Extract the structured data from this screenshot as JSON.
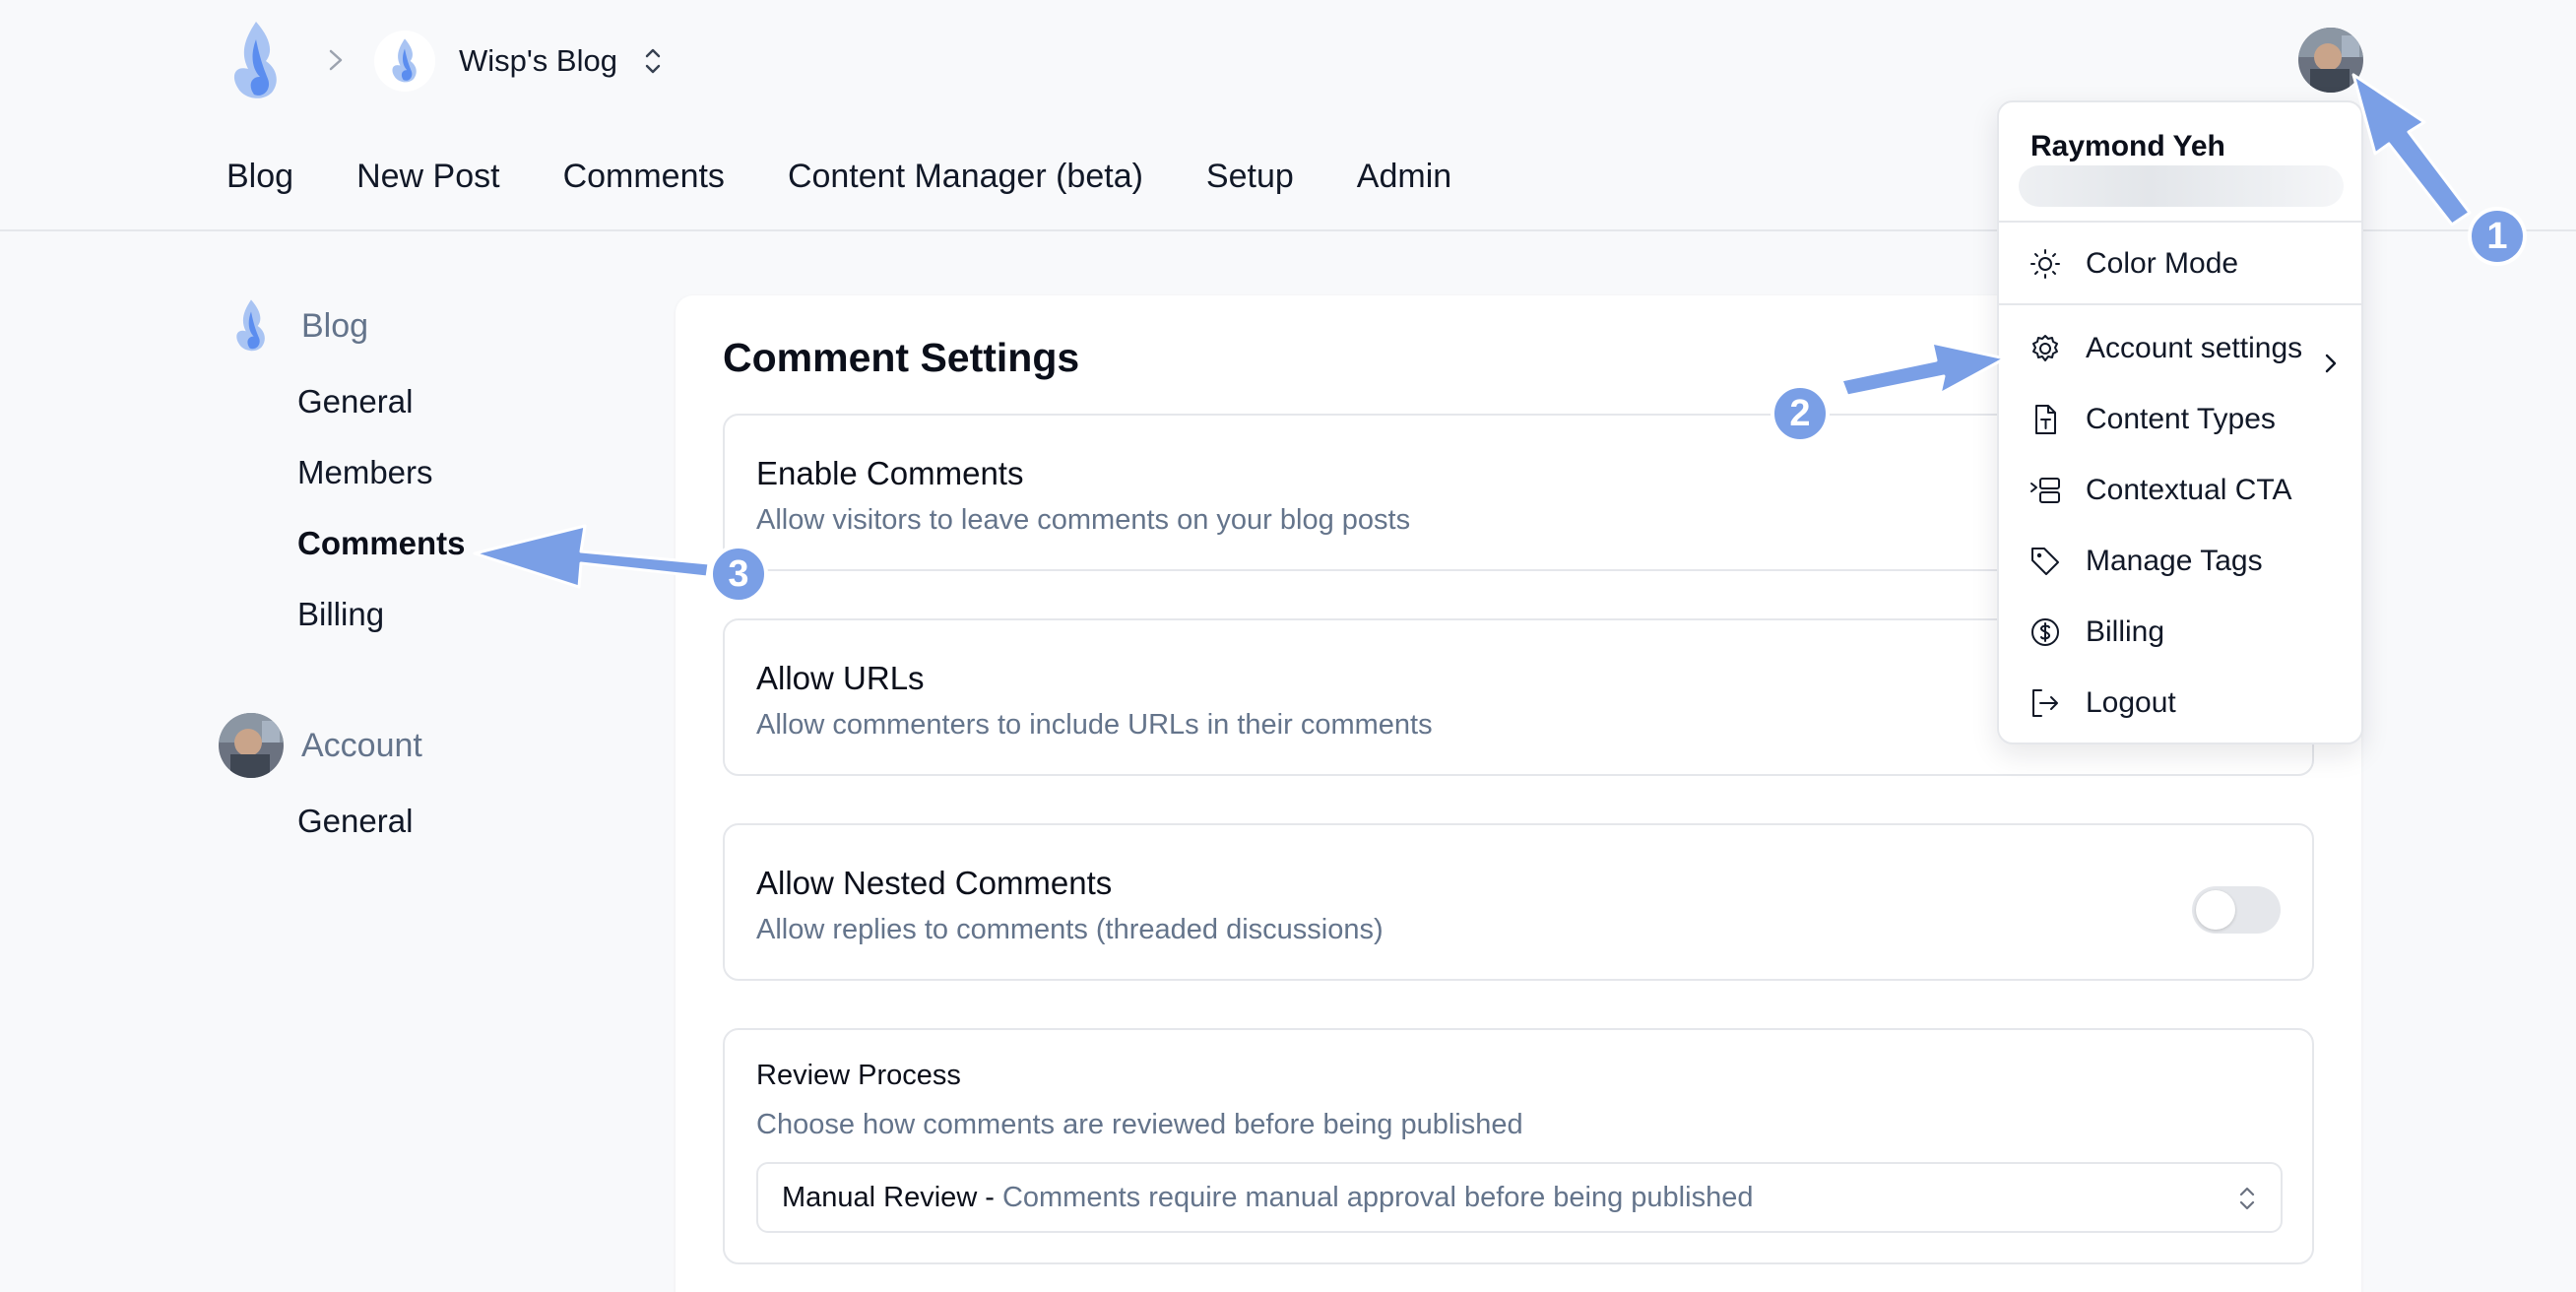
{
  "header": {
    "blog_name": "Wisp's Blog",
    "nav": [
      "Blog",
      "New Post",
      "Comments",
      "Content Manager (beta)",
      "Setup",
      "Admin"
    ]
  },
  "sidebar": {
    "blog_group": {
      "label": "Blog",
      "items": [
        {
          "label": "General",
          "active": false
        },
        {
          "label": "Members",
          "active": false
        },
        {
          "label": "Comments",
          "active": true
        },
        {
          "label": "Billing",
          "active": false
        }
      ]
    },
    "account_group": {
      "label": "Account",
      "items": [
        {
          "label": "General",
          "active": false
        }
      ]
    }
  },
  "main": {
    "title": "Comment Settings",
    "settings": [
      {
        "title": "Enable Comments",
        "description": "Allow visitors to leave comments on your blog posts"
      },
      {
        "title": "Allow URLs",
        "description": "Allow commenters to include URLs in their comments"
      },
      {
        "title": "Allow Nested Comments",
        "description": "Allow replies to comments (threaded discussions)",
        "enabled": false
      }
    ],
    "review": {
      "title": "Review Process",
      "description": "Choose how comments are reviewed before being published",
      "selected_label": "Manual Review",
      "selected_separator": "-",
      "selected_description": "Comments require manual approval before being published"
    }
  },
  "menu": {
    "user_name": "Raymond Yeh",
    "items": [
      {
        "label": "Color Mode",
        "icon": "sun-icon"
      },
      {
        "label": "Account settings",
        "icon": "gear-icon"
      },
      {
        "label": "Content Types",
        "icon": "file-type-icon"
      },
      {
        "label": "Contextual CTA",
        "icon": "cta-layout-icon"
      },
      {
        "label": "Manage Tags",
        "icon": "tag-icon"
      },
      {
        "label": "Billing",
        "icon": "dollar-circle-icon"
      },
      {
        "label": "Logout",
        "icon": "logout-icon"
      }
    ]
  },
  "annotations": {
    "badges": [
      "1",
      "2",
      "3"
    ],
    "color": "#7a9fe6"
  },
  "colors": {
    "brand_flame": "#5b8def",
    "toggle_off": "#e5e7eb",
    "muted_text": "#64748b"
  }
}
